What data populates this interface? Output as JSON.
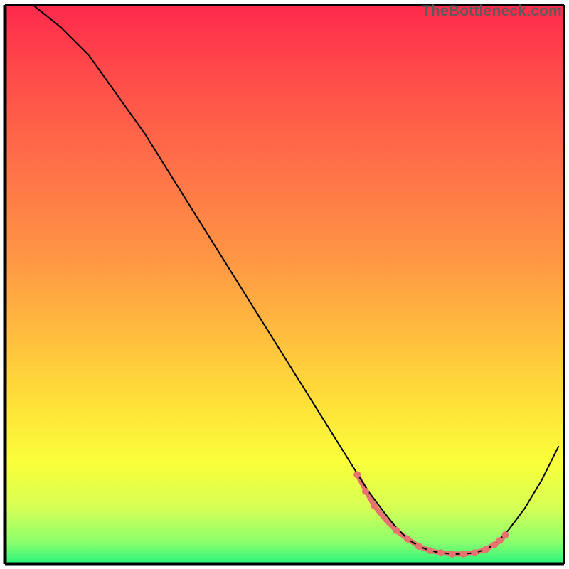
{
  "watermark": "TheBottleneck.com",
  "gradient": {
    "stops": [
      {
        "offset": "0%",
        "color": "#ff2a4c"
      },
      {
        "offset": "12%",
        "color": "#ff4a4a"
      },
      {
        "offset": "28%",
        "color": "#ff6f48"
      },
      {
        "offset": "45%",
        "color": "#ff9544"
      },
      {
        "offset": "60%",
        "color": "#ffc03e"
      },
      {
        "offset": "72%",
        "color": "#ffe338"
      },
      {
        "offset": "82%",
        "color": "#f9ff3a"
      },
      {
        "offset": "90%",
        "color": "#d6ff55"
      },
      {
        "offset": "96%",
        "color": "#8cff6d"
      },
      {
        "offset": "100%",
        "color": "#28f47c"
      }
    ]
  },
  "axis_color": "#000000",
  "curve_color": "#000000",
  "curve_width": 2.0,
  "marker_color": "#e6736f",
  "marker_line_width": 7,
  "marker_radius": 5,
  "chart_data": {
    "type": "line",
    "title": "",
    "xlabel": "",
    "ylabel": "",
    "xlim": [
      0,
      100
    ],
    "ylim": [
      0,
      100
    ],
    "grid": false,
    "legend": false,
    "series": [
      {
        "name": "curve",
        "x": [
          5,
          10,
          15,
          20,
          25,
          30,
          35,
          40,
          45,
          50,
          55,
          60,
          65,
          68,
          70,
          72,
          74,
          76,
          78,
          80,
          82,
          84,
          86,
          88,
          90,
          93,
          96,
          99
        ],
        "y": [
          100,
          96,
          91,
          84,
          77,
          69,
          61,
          53,
          45,
          37,
          29,
          21,
          13,
          9,
          6.5,
          4.5,
          3.2,
          2.4,
          2.0,
          1.8,
          1.8,
          2.0,
          2.6,
          3.8,
          6.0,
          10,
          15,
          21
        ]
      }
    ],
    "highlight_segment": {
      "comment": "flat valley near the minimum, thick salmon stroke with dots",
      "x": [
        63,
        66,
        68,
        70,
        72,
        74,
        76,
        78,
        80,
        82,
        84,
        86,
        88,
        89
      ],
      "y": [
        16,
        10.5,
        8,
        6,
        4.5,
        3.2,
        2.4,
        2.0,
        1.8,
        1.8,
        2.0,
        2.6,
        3.8,
        4.6
      ]
    },
    "highlight_dots": {
      "x": [
        63,
        64.5,
        66,
        70,
        72,
        74,
        76,
        78,
        80,
        82,
        84,
        86,
        87.5,
        88.5,
        89.5
      ],
      "y": [
        16,
        13,
        10.5,
        6,
        4.5,
        3.2,
        2.4,
        2.0,
        1.8,
        1.8,
        2.0,
        2.6,
        3.4,
        4.2,
        5.2
      ]
    }
  }
}
